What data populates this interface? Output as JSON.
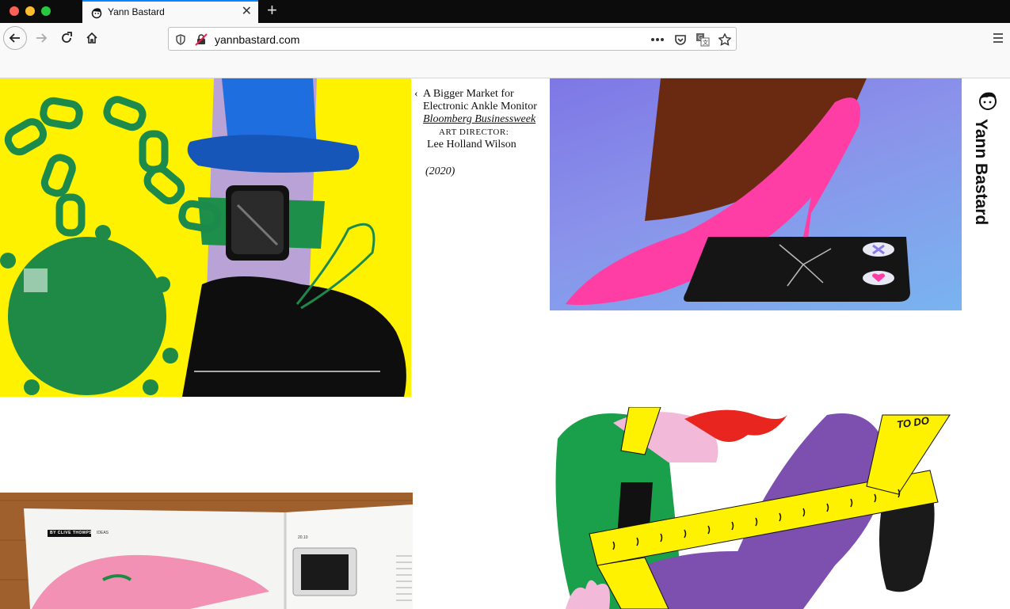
{
  "browser": {
    "tab": {
      "title": "Yann Bastard"
    },
    "address_bar": {
      "url": "yannbastard.com"
    }
  },
  "caption": {
    "back": "‹",
    "title": "A Bigger Market for Electronic Ankle Monitor",
    "publication": "Bloomberg Businessweek",
    "role": "art director:",
    "person": "Lee Holland Wilson",
    "year": "(2020)"
  },
  "brand": {
    "name": "Yann Bastard"
  },
  "magazine": {
    "byline": "BY CLIVE THOMPSON",
    "section": "IDEAS",
    "page": "20.10"
  },
  "todo_tape": {
    "text": "TO DO"
  }
}
